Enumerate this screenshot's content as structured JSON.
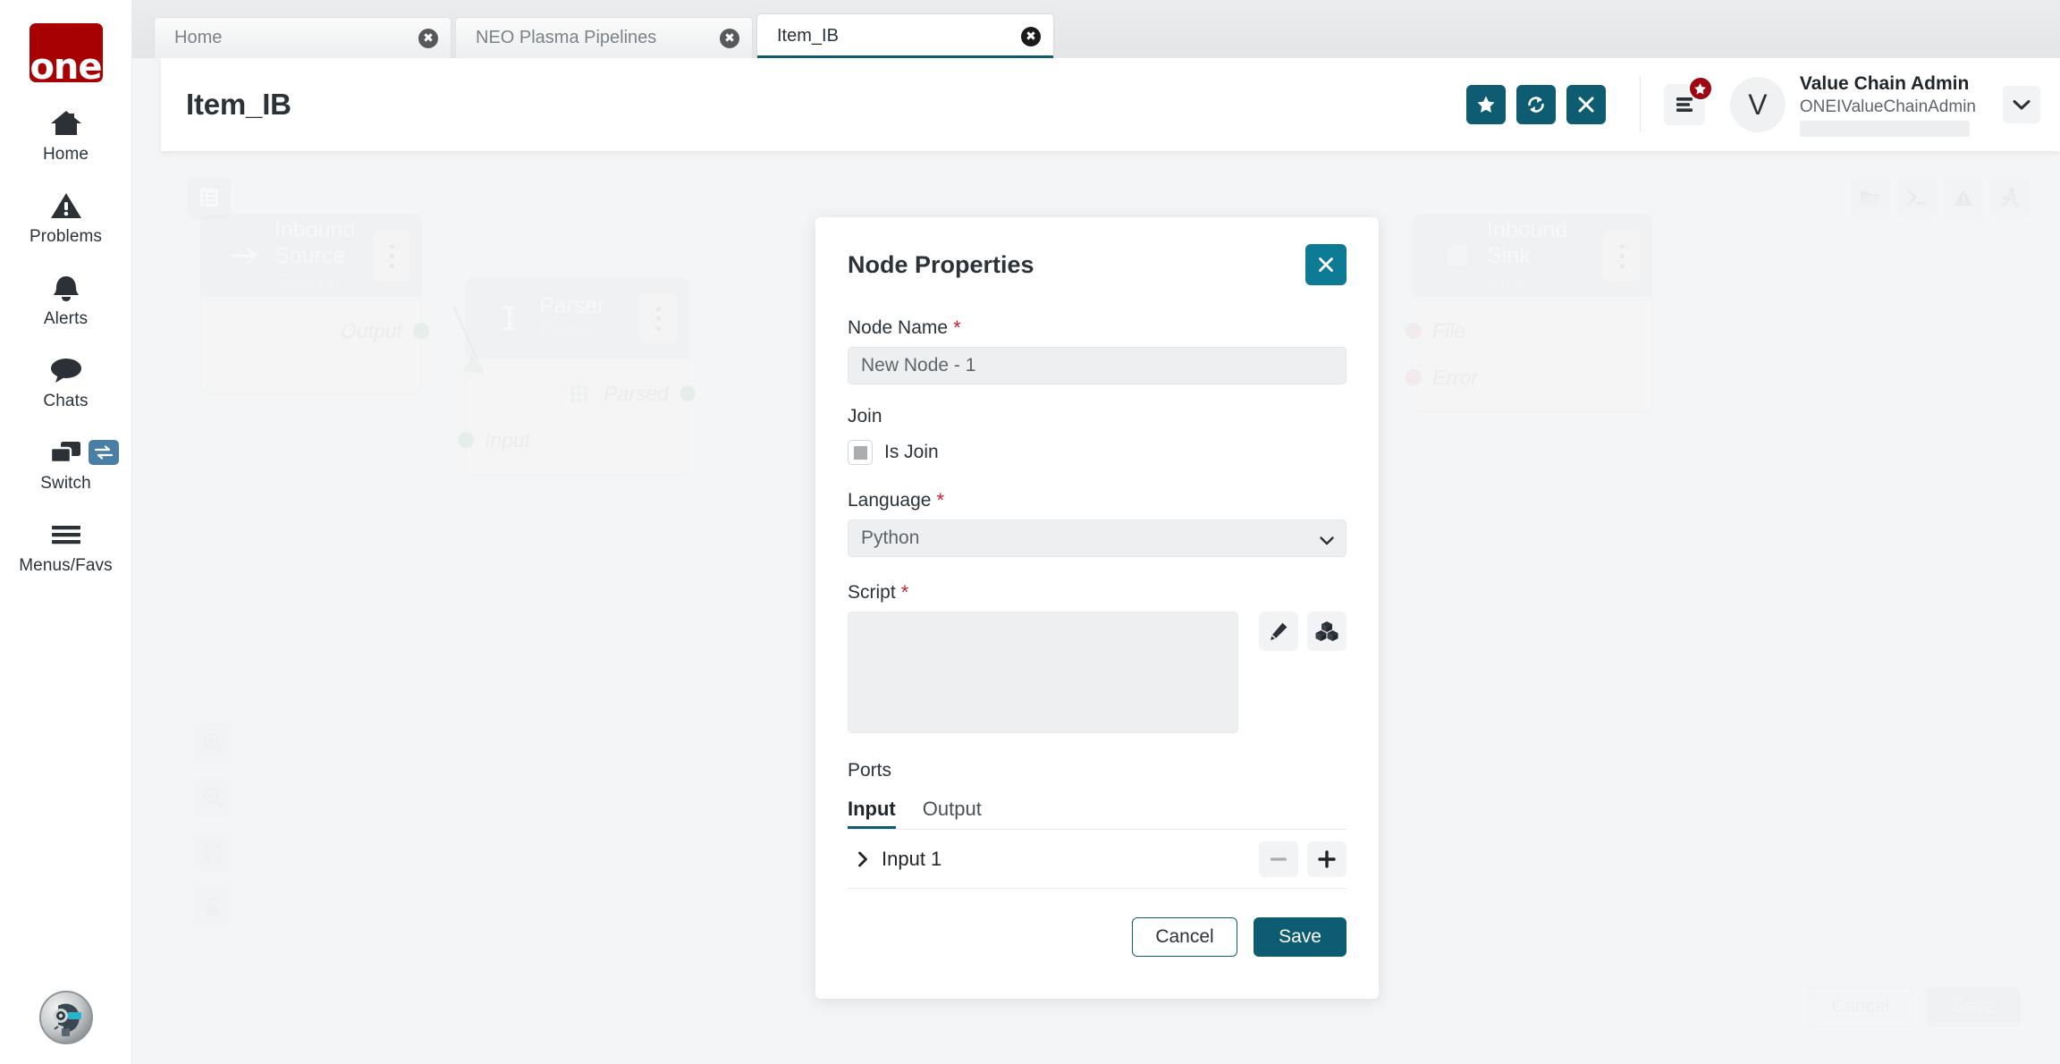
{
  "brand": {
    "logo_text": "one",
    "logo_color": "#a80104"
  },
  "theme": {
    "accent_teal": "#0d5c72",
    "accent_teal_light": "#0d7b96",
    "badge_red": "#9e0712",
    "required_red": "#d21d2f"
  },
  "rail": {
    "items": [
      {
        "label": "Home",
        "icon": "home-icon"
      },
      {
        "label": "Problems",
        "icon": "warning-triangle-icon"
      },
      {
        "label": "Alerts",
        "icon": "bell-icon"
      },
      {
        "label": "Chats",
        "icon": "chat-bubble-icon"
      },
      {
        "label": "Switch",
        "icon": "windows-icon",
        "badge_icon": "swap-arrows-icon"
      },
      {
        "label": "Menus/Favs",
        "icon": "hamburger-icon"
      }
    ],
    "assistant_icon": "ai-assistant-avatar"
  },
  "tabs": [
    {
      "label": "Home",
      "active": false,
      "close_icon": "close-circle-icon"
    },
    {
      "label": "NEO Plasma Pipelines",
      "active": false,
      "close_icon": "close-circle-icon"
    },
    {
      "label": "Item_IB",
      "active": true,
      "close_icon": "close-circle-icon"
    }
  ],
  "header": {
    "page_title": "Item_IB",
    "actions": [
      {
        "icon": "star-icon",
        "name": "favorite-button"
      },
      {
        "icon": "refresh-icon",
        "name": "refresh-button"
      },
      {
        "icon": "close-x-icon",
        "name": "close-button"
      }
    ],
    "menus_icon": "list-menu-icon",
    "menus_badge_icon": "star-icon",
    "user": {
      "avatar_initial": "V",
      "name": "Value Chain Admin",
      "login": "ONEIValueChainAdmin",
      "chevron_icon": "chevron-down-icon"
    }
  },
  "canvas": {
    "list_button_icon": "list-panel-icon",
    "top_tools": [
      {
        "icon": "folder-open-icon",
        "name": "open-folder-tool"
      },
      {
        "icon": "terminal-icon",
        "name": "terminal-tool"
      },
      {
        "icon": "warning-triangle-icon",
        "name": "alerts-tool"
      },
      {
        "icon": "run-person-icon",
        "name": "run-tool"
      }
    ],
    "left_tools": [
      {
        "icon": "zoom-in-icon",
        "name": "zoom-in-tool"
      },
      {
        "icon": "zoom-out-icon",
        "name": "zoom-out-tool"
      },
      {
        "icon": "fit-screen-icon",
        "name": "fit-to-screen-tool"
      },
      {
        "icon": "unlock-icon",
        "name": "lock-canvas-tool"
      }
    ],
    "nodes": [
      {
        "title": "Inbound Source",
        "subtitle": "Source",
        "icon": "arrow-right-icon",
        "ports": [
          {
            "label": "Output",
            "side": "out",
            "dot": "green"
          }
        ]
      },
      {
        "title": "Parser",
        "subtitle": "Parse",
        "icon": "text-cursor-icon",
        "ports": [
          {
            "label": "Parsed",
            "side": "out",
            "dot": "green",
            "grid_icon": "grid-icon"
          },
          {
            "label": "Input",
            "side": "in",
            "dot": "green"
          }
        ]
      },
      {
        "title": "Inbound Sink",
        "subtitle": "Sink",
        "icon": "square-icon",
        "ports": [
          {
            "label": "File",
            "side": "in",
            "dot": "red"
          },
          {
            "label": "Error",
            "side": "in",
            "dot": "red"
          }
        ]
      }
    ],
    "footer": {
      "cancel_label": "Cancel",
      "save_label": "Save"
    }
  },
  "modal": {
    "title": "Node Properties",
    "close_icon": "close-x-icon",
    "node_name": {
      "label": "Node Name",
      "required": true,
      "value": "New Node - 1",
      "placeholder": "New Node - 1"
    },
    "join": {
      "label": "Join",
      "checkbox_label": "Is Join",
      "checked": false,
      "state": "filled-gray"
    },
    "language": {
      "label": "Language",
      "required": true,
      "value": "Python",
      "options": [
        "Python"
      ],
      "caret_icon": "chevron-down-icon"
    },
    "script": {
      "label": "Script",
      "required": true,
      "value": "",
      "placeholder": "",
      "actions": [
        {
          "icon": "pencil-edit-icon",
          "name": "edit-script-button"
        },
        {
          "icon": "cubes-packages-icon",
          "name": "script-packages-button"
        }
      ]
    },
    "ports": {
      "label": "Ports",
      "tabs": [
        {
          "label": "Input",
          "active": true
        },
        {
          "label": "Output",
          "active": false
        }
      ],
      "rows": [
        {
          "name": "Input 1",
          "expand_icon": "chevron-right-icon",
          "remove_icon": "minus-icon",
          "add_icon": "plus-icon"
        }
      ]
    },
    "footer": {
      "cancel_label": "Cancel",
      "save_label": "Save"
    }
  }
}
